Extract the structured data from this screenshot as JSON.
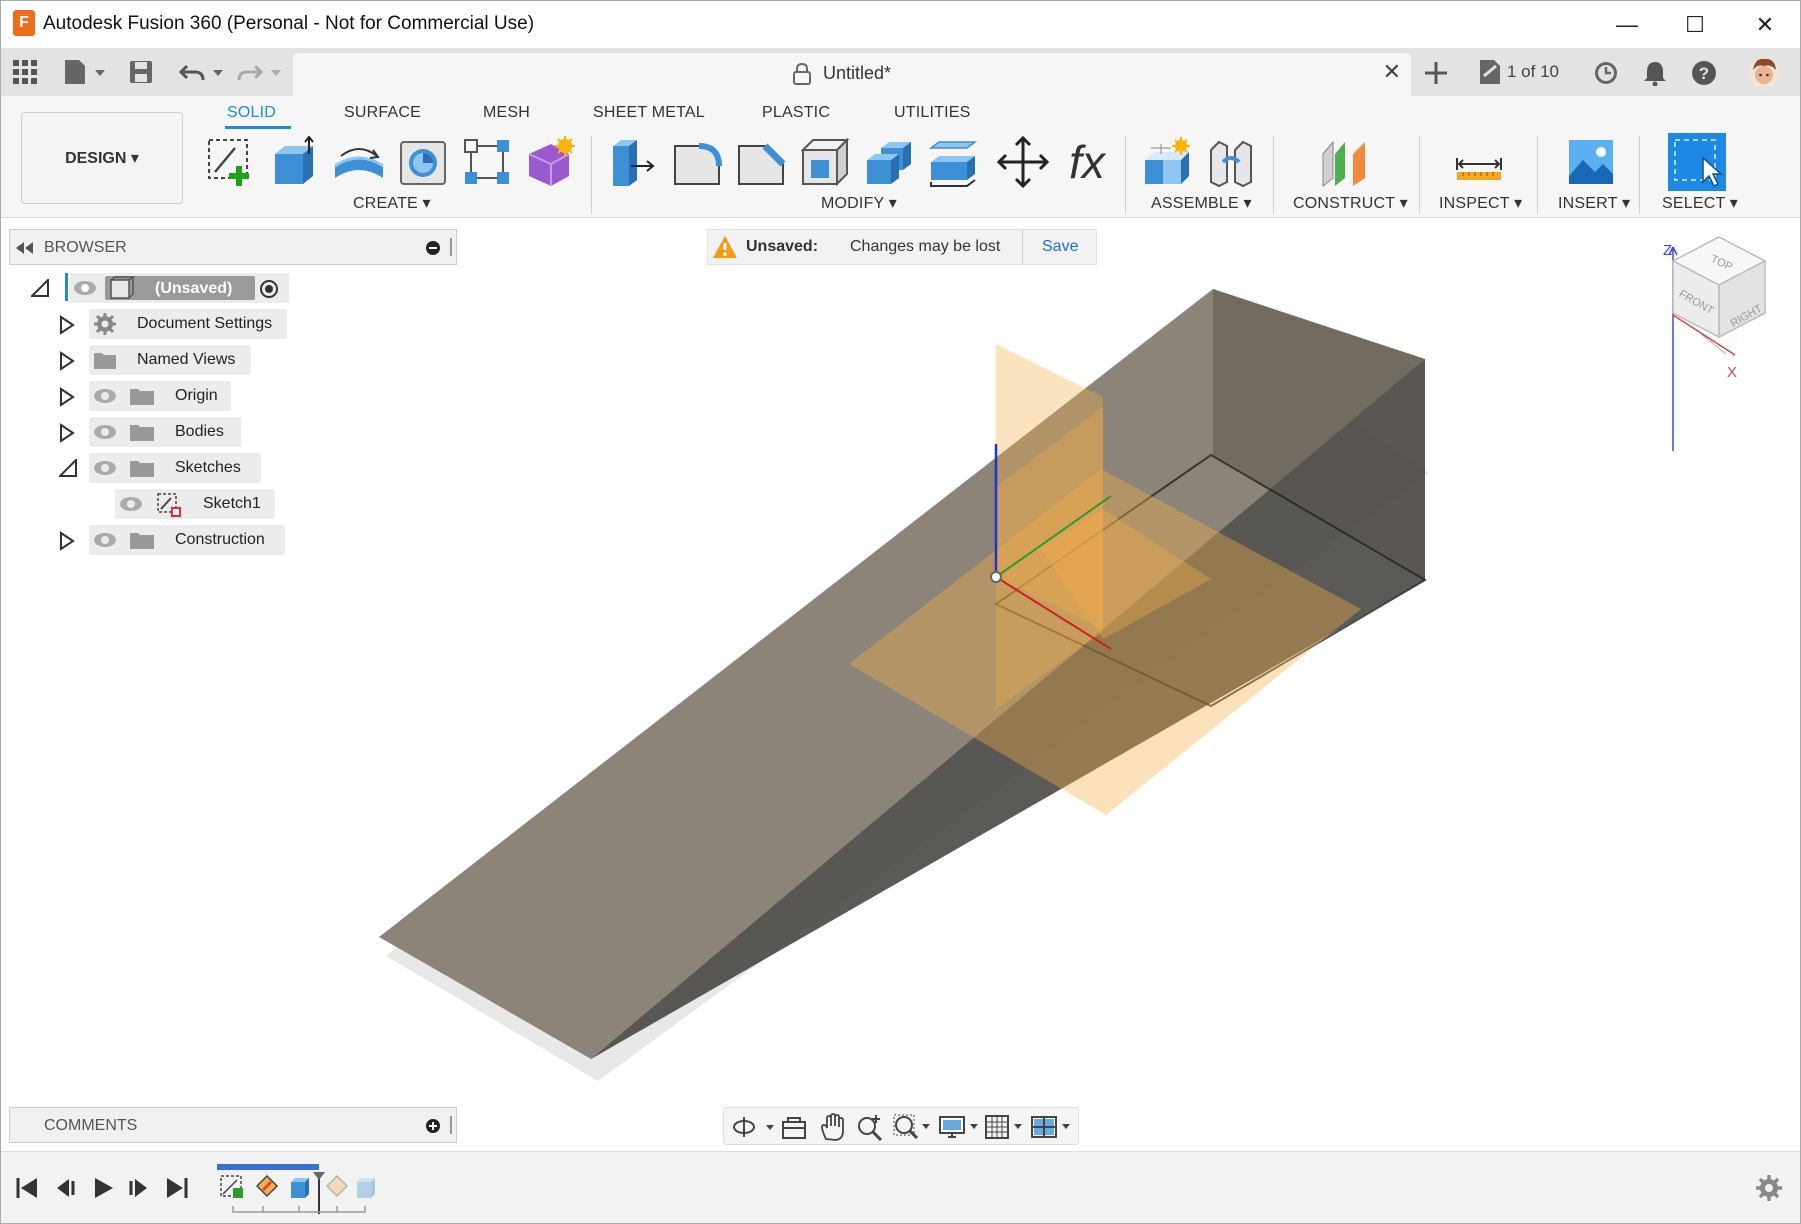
{
  "window": {
    "title": "Autodesk Fusion 360 (Personal - Not for Commercial Use)",
    "app_icon_letter": "F"
  },
  "quick_access": {
    "doc_tab_title": "Untitled*",
    "job_status": "1 of 10"
  },
  "ribbon": {
    "workspace_label": "DESIGN ▾",
    "tabs": [
      "SOLID",
      "SURFACE",
      "MESH",
      "SHEET METAL",
      "PLASTIC",
      "UTILITIES"
    ],
    "active_tab": "SOLID",
    "groups": [
      "CREATE ▾",
      "MODIFY ▾",
      "ASSEMBLE ▾",
      "CONSTRUCT ▾",
      "INSPECT ▾",
      "INSERT ▾",
      "SELECT ▾"
    ],
    "fx_glyph": "fx"
  },
  "browser": {
    "title": "BROWSER",
    "root": "(Unsaved)",
    "items": [
      "Document Settings",
      "Named Views",
      "Origin",
      "Bodies",
      "Sketches",
      "Sketch1",
      "Construction"
    ]
  },
  "warning": {
    "label": "Unsaved:",
    "message": "Changes may be lost",
    "save_label": "Save"
  },
  "viewcube": {
    "top": "TOP",
    "front": "FRONT",
    "right": "RIGHT",
    "axis_z": "Z",
    "axis_x": "X"
  },
  "comments": {
    "title": "COMMENTS"
  },
  "colors": {
    "accent": "#1e88e5",
    "body_face": "#8c8478",
    "plane": "#f5b04a",
    "warning": "#f39c12"
  }
}
